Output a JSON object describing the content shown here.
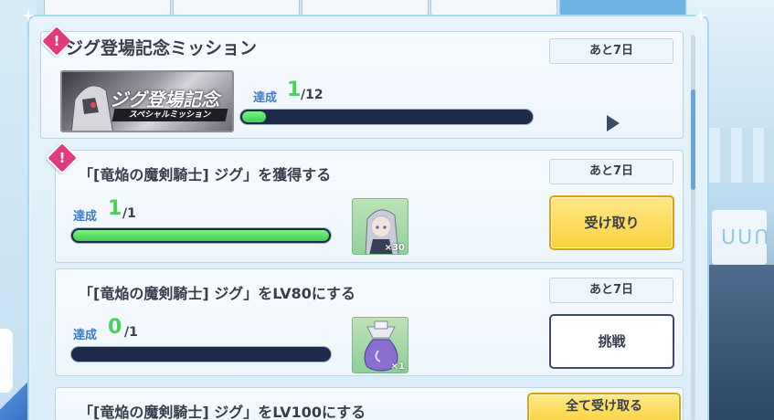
{
  "event": {
    "title": "ジグ登場記念ミッション",
    "days_left": "あと7日",
    "banner_title": "ジグ登場記念",
    "banner_subtitle": "スペシャルミッション",
    "achievement_label": "達成",
    "achieved": "1",
    "total": "/12",
    "progress_fraction": 0.083
  },
  "missions": [
    {
      "title": "「[竜焔の魔剣騎士] ジグ」を獲得する",
      "days_left": "あと7日",
      "achievement_label": "達成",
      "achieved": "1",
      "total": "/1",
      "progress_fraction": 1.0,
      "reward_qty": "×30",
      "reward_icon": "character-portrait-icon",
      "button_label": "受け取り",
      "button_state": "claim"
    },
    {
      "title": "「[竜焔の魔剣騎士] ジグ」をLV80にする",
      "days_left": "あと7日",
      "achievement_label": "達成",
      "achieved": "0",
      "total": "/1",
      "progress_fraction": 0.0,
      "reward_qty": "×1",
      "reward_icon": "item-bag-icon",
      "button_label": "挑戦",
      "button_state": "challenge"
    },
    {
      "title": "「[竜焔の魔剣騎士] ジグ」をLV100にする"
    }
  ],
  "claim_all_label": "全て受け取る",
  "colors": {
    "accent_badge": "#e23a7e",
    "progress_fill": "#3fd14f",
    "button_gold": "#f9d23c",
    "bar_track": "#1e2a4a"
  }
}
